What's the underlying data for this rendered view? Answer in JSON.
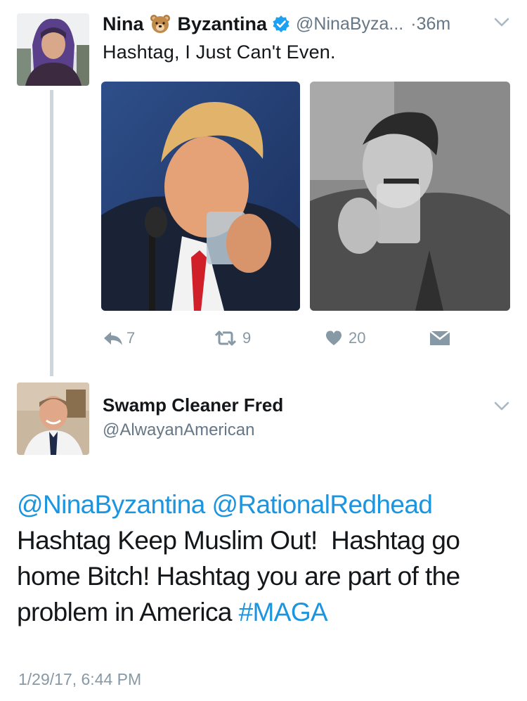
{
  "tweet1": {
    "name_first": "Nina",
    "name_emoji": "bear-face-emoji",
    "name_last": "Byzantina",
    "verified_icon": "verified-badge-icon",
    "handle": "@NinaByza...",
    "time": "·36m",
    "text": "Hashtag, I Just Can't Even.",
    "actions": {
      "reply_count": "7",
      "retweet_count": "9",
      "like_count": "20"
    }
  },
  "tweet2": {
    "name": "Swamp Cleaner Fred",
    "handle": "@AlwayanAmerican",
    "mention1": "@NinaByzantina",
    "mention2": "@RationalRedhead",
    "line1": "Hashtag Keep Muslim Out!  Hashtag go",
    "line2": "home Bitch! Hashtag you are part of the",
    "line3": "problem in America ",
    "hashtag": "#MAGA",
    "timestamp": "1/29/17, 6:44 PM"
  },
  "colors": {
    "link": "#1b95e0",
    "verified": "#1da1f2",
    "muted": "#8899a6"
  }
}
